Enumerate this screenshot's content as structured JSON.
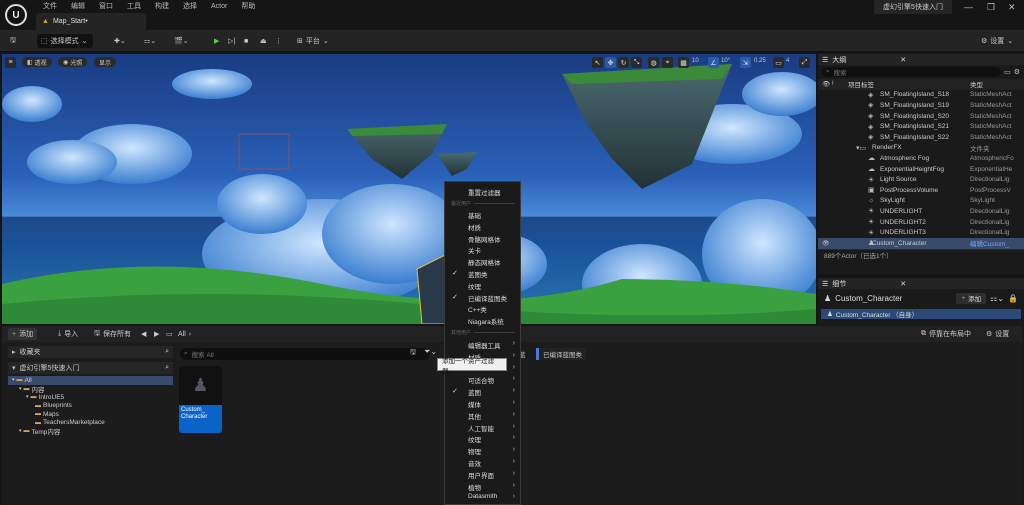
{
  "titlebar": {
    "menu": [
      "文件",
      "编辑",
      "窗口",
      "工具",
      "构建",
      "选择",
      "Actor",
      "帮助"
    ],
    "tab": "Map_Start•",
    "project": "虚幻引擎5快速入门"
  },
  "toolbar": {
    "mode": "选择模式",
    "platform": "平台",
    "settings": "设置"
  },
  "viewport": {
    "perspective": "透视",
    "lit": "光照",
    "show": "显示",
    "grid": "10",
    "angle": "10°",
    "scale": "0.25",
    "cams": "4"
  },
  "outliner": {
    "title": "大纲",
    "search_placeholder": "搜索",
    "col_label": "项目标签",
    "col_type": "类型",
    "rows": [
      {
        "name": "SM_FloatingIsland_S18",
        "type": "StaticMeshAct",
        "icon": "◈"
      },
      {
        "name": "SM_FloatingIsland_S19",
        "type": "StaticMeshAct",
        "icon": "◈"
      },
      {
        "name": "SM_FloatingIsland_S20",
        "type": "StaticMeshAct",
        "icon": "◈"
      },
      {
        "name": "SM_FloatingIsland_S21",
        "type": "StaticMeshAct",
        "icon": "◈"
      },
      {
        "name": "SM_FloatingIsland_S22",
        "type": "StaticMeshAct",
        "icon": "◈"
      },
      {
        "name": "RenderFX",
        "type": "文件夹",
        "icon": "▾▭",
        "folder": true
      },
      {
        "name": "Atmospheric Fog",
        "type": "AtmosphericFo",
        "icon": "☁"
      },
      {
        "name": "ExponentialHeightFog",
        "type": "ExponentialHe",
        "icon": "☁"
      },
      {
        "name": "Light Source",
        "type": "DirectionalLig",
        "icon": "☀"
      },
      {
        "name": "PostProcessVolume",
        "type": "PostProcessV",
        "icon": "▣"
      },
      {
        "name": "SkyLight",
        "type": "SkyLight",
        "icon": "☼"
      },
      {
        "name": "UNDERLIGHT",
        "type": "DirectionalLig",
        "icon": "☀"
      },
      {
        "name": "UNDERLIGHT2",
        "type": "DirectionalLig",
        "icon": "☀"
      },
      {
        "name": "UNDERLIGHT3",
        "type": "DirectionalLig",
        "icon": "☀"
      },
      {
        "name": "Custom_Character",
        "type": "编辑Custom_",
        "icon": "♟",
        "selected": true
      }
    ],
    "status": "889个Actor（已选1个）"
  },
  "details": {
    "title": "细节",
    "actor": "Custom_Character",
    "add": "添加",
    "component": "Custom_Character （自身）",
    "dock": "停靠在布局中",
    "settings": "设置"
  },
  "contentbrowser": {
    "add": "添加",
    "import": "导入",
    "saveall": "保存所有",
    "path": "All",
    "favorites": "收藏夹",
    "project": "虚幻引擎5快速入门",
    "tree": [
      {
        "label": "All",
        "level": 0,
        "selected": true
      },
      {
        "label": "内容",
        "level": 1
      },
      {
        "label": "IntroUE5",
        "level": 2
      },
      {
        "label": "Blueprints",
        "level": 3
      },
      {
        "label": "Maps",
        "level": 3
      },
      {
        "label": "TeachersMarketplace",
        "level": 3
      },
      {
        "label": "Temp内容",
        "level": 1
      }
    ],
    "search_placeholder": "搜索 All",
    "asset": "Custom_\nCharacter",
    "filter_chip": "已编译蓝图类",
    "filter_chip_left": "蓝"
  },
  "dropdown": {
    "reset": "重置过滤器",
    "sec1": "最近用户",
    "sec2": "其他用户",
    "items": [
      {
        "label": "基础",
        "check": false,
        "arrow": false
      },
      {
        "label": "材质",
        "check": false,
        "arrow": false
      },
      {
        "label": "骨骼网格体",
        "check": false,
        "arrow": false
      },
      {
        "label": "关卡",
        "check": false,
        "arrow": false
      },
      {
        "label": "静态网格体",
        "check": false,
        "arrow": false
      },
      {
        "label": "蓝图类",
        "check": true,
        "arrow": false
      },
      {
        "label": "纹理",
        "check": false,
        "arrow": false
      },
      {
        "label": "已编译蓝图类",
        "check": true,
        "arrow": false
      },
      {
        "label": "C++类",
        "check": false,
        "arrow": false
      },
      {
        "label": "Niagara系统",
        "check": false,
        "arrow": false
      }
    ],
    "items2": [
      {
        "label": "编辑器工具",
        "check": false,
        "arrow": true
      },
      {
        "label": "材质",
        "check": false,
        "arrow": true
      },
      {
        "label": "",
        "check": false,
        "arrow": true
      },
      {
        "label": "可适合物",
        "check": false,
        "arrow": true
      },
      {
        "label": "蓝图",
        "check": true,
        "arrow": true
      },
      {
        "label": "媒体",
        "check": false,
        "arrow": true
      },
      {
        "label": "其他",
        "check": false,
        "arrow": true
      },
      {
        "label": "人工智能",
        "check": false,
        "arrow": true
      },
      {
        "label": "纹理",
        "check": false,
        "arrow": true
      },
      {
        "label": "物理",
        "check": false,
        "arrow": true
      },
      {
        "label": "音效",
        "check": false,
        "arrow": true
      },
      {
        "label": "用户界面",
        "check": false,
        "arrow": true
      },
      {
        "label": "植物",
        "check": false,
        "arrow": true
      },
      {
        "label": "Datasmith",
        "check": false,
        "arrow": true
      }
    ]
  },
  "tooltip": "添加一个资产过滤器。"
}
